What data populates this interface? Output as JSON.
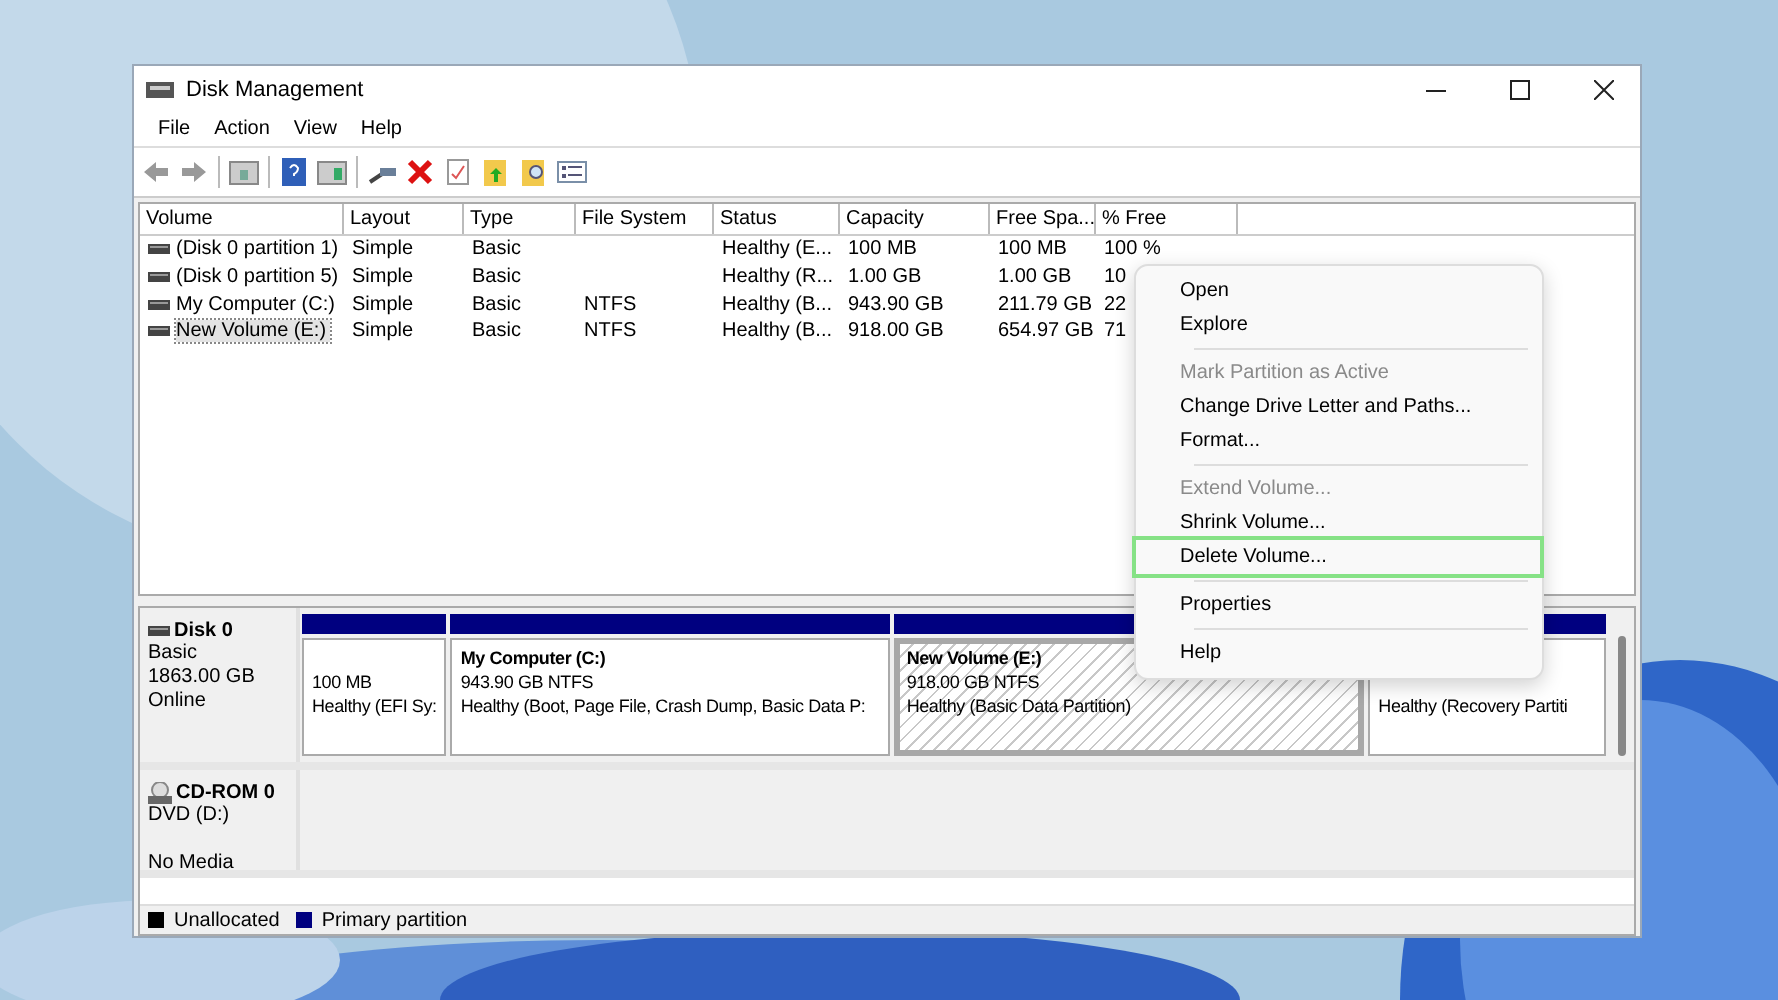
{
  "window": {
    "title": "Disk Management"
  },
  "menu_bar": [
    "File",
    "Action",
    "View",
    "Help"
  ],
  "table": {
    "columns": [
      "Volume",
      "Layout",
      "Type",
      "File System",
      "Status",
      "Capacity",
      "Free Spa...",
      "% Free"
    ],
    "rows": [
      {
        "selected": false,
        "cells": [
          "(Disk 0 partition 1)",
          "Simple",
          "Basic",
          "",
          "Healthy (E...",
          "100 MB",
          "100 MB",
          "100 %"
        ]
      },
      {
        "selected": false,
        "cells": [
          "(Disk 0 partition 5)",
          "Simple",
          "Basic",
          "",
          "Healthy (R...",
          "1.00 GB",
          "1.00 GB",
          "10"
        ]
      },
      {
        "selected": false,
        "cells": [
          "My Computer (C:)",
          "Simple",
          "Basic",
          "NTFS",
          "Healthy (B...",
          "943.90 GB",
          "211.79 GB",
          "22"
        ]
      },
      {
        "selected": true,
        "cells": [
          "New Volume (E:)",
          "Simple",
          "Basic",
          "NTFS",
          "Healthy (B...",
          "918.00 GB",
          "654.97 GB",
          "71"
        ]
      }
    ]
  },
  "disks": [
    {
      "kind": "disk",
      "name": "Disk 0",
      "lines": [
        "Basic",
        "1863.00 GB",
        "Online"
      ],
      "partitions": [
        {
          "selected": false,
          "size": "100 MB",
          "status": "Healthy (EFI Sy:"
        },
        {
          "selected": false,
          "name": "My Computer  (C:)",
          "size": "943.90 GB NTFS",
          "status": "Healthy (Boot, Page File, Crash Dump, Basic Data P:"
        },
        {
          "selected": true,
          "name": "New Volume  (E:)",
          "size": "918.00 GB NTFS",
          "status": "Healthy (Basic Data Partition)"
        },
        {
          "selected": false,
          "status": "Healthy (Recovery Partiti"
        }
      ]
    },
    {
      "kind": "cdrom",
      "name": "CD-ROM 0",
      "lines": [
        "DVD (D:)",
        "No Media"
      ]
    }
  ],
  "legend": [
    {
      "label": "Unallocated",
      "color": "#000000"
    },
    {
      "label": "Primary partition",
      "color": "#000080"
    }
  ],
  "context_menu": [
    {
      "kind": "item",
      "label": "Open",
      "disabled": false,
      "highlighted": false
    },
    {
      "kind": "item",
      "label": "Explore",
      "disabled": false,
      "highlighted": false
    },
    {
      "kind": "separator"
    },
    {
      "kind": "item",
      "label": "Mark Partition as Active",
      "disabled": true,
      "highlighted": false
    },
    {
      "kind": "item",
      "label": "Change Drive Letter and Paths...",
      "disabled": false,
      "highlighted": false
    },
    {
      "kind": "item",
      "label": "Format...",
      "disabled": false,
      "highlighted": false
    },
    {
      "kind": "separator"
    },
    {
      "kind": "item",
      "label": "Extend Volume...",
      "disabled": true,
      "highlighted": false
    },
    {
      "kind": "item",
      "label": "Shrink Volume...",
      "disabled": false,
      "highlighted": false
    },
    {
      "kind": "item",
      "label": "Delete Volume...",
      "disabled": false,
      "highlighted": true
    },
    {
      "kind": "separator"
    },
    {
      "kind": "item",
      "label": "Properties",
      "disabled": false,
      "highlighted": false
    },
    {
      "kind": "separator"
    },
    {
      "kind": "item",
      "label": "Help",
      "disabled": false,
      "highlighted": false
    }
  ]
}
